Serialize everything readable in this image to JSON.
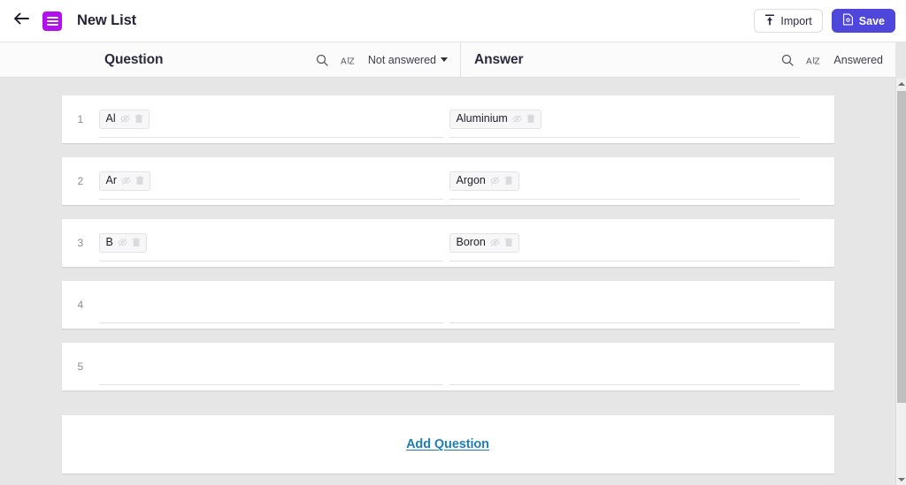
{
  "appbar": {
    "back_icon": "arrow-left-icon",
    "logo_icon": "list-app-logo-icon",
    "title": "New List",
    "import": {
      "label": "Import",
      "icon": "upload-icon"
    },
    "save": {
      "label": "Save",
      "icon": "save-document-icon"
    }
  },
  "columns": {
    "question": {
      "title": "Question",
      "search_icon": "search-icon",
      "sort_icon": "sort-az-icon",
      "filter_label": "Not answered",
      "filter_has_caret": true
    },
    "answer": {
      "title": "Answer",
      "search_icon": "search-icon",
      "sort_icon": "sort-az-icon",
      "filter_label": "Answered",
      "filter_has_caret": false
    }
  },
  "chip_icons": {
    "hide": "eye-off-icon",
    "delete": "trash-icon"
  },
  "rows": [
    {
      "num": "1",
      "question": "Al",
      "answer": "Aluminium"
    },
    {
      "num": "2",
      "question": "Ar",
      "answer": "Argon"
    },
    {
      "num": "3",
      "question": "B",
      "answer": "Boron"
    },
    {
      "num": "4",
      "question": "",
      "answer": ""
    },
    {
      "num": "5",
      "question": "",
      "answer": ""
    }
  ],
  "add_question": {
    "label": "Add Question"
  },
  "colors": {
    "brand_purple": "#b40ff0",
    "save_blue": "#4f46db",
    "link_blue": "#1f7fb5",
    "page_bg": "#e6e6e6"
  },
  "scrollbar": {
    "up_icon": "scroll-up-arrow-icon",
    "down_icon": "scroll-down-arrow-icon"
  }
}
